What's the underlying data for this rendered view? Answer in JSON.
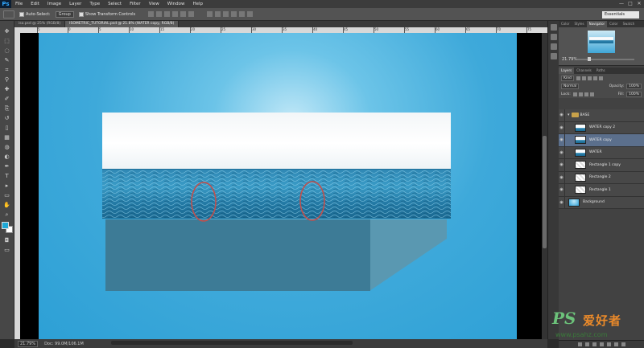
{
  "app": {
    "logo": "Ps",
    "menu": [
      "File",
      "Edit",
      "Image",
      "Layer",
      "Type",
      "Select",
      "Filter",
      "View",
      "Window",
      "Help"
    ],
    "window_controls": [
      "—",
      "□",
      "✕"
    ]
  },
  "options_bar": {
    "auto_select_label": "Auto-Select:",
    "auto_select_value": "Group",
    "transform_controls_label": "Show Transform Controls",
    "workspace": "Essentials"
  },
  "document_tabs": [
    {
      "label": "iso.psd @ 25% (RGB/8)",
      "active": false
    },
    {
      "label": "ISOMETRIC_TUTORIAL.psd @ 21.8% (WATER copy, RGB/8)",
      "active": true
    }
  ],
  "toolbar": {
    "tools": [
      "move-tool",
      "marquee-tool",
      "lasso-tool",
      "quick-select-tool",
      "crop-tool",
      "eyedropper-tool",
      "healing-tool",
      "brush-tool",
      "clone-tool",
      "history-brush-tool",
      "eraser-tool",
      "gradient-tool",
      "blur-tool",
      "dodge-tool",
      "pen-tool",
      "type-tool",
      "path-select-tool",
      "shape-tool",
      "hand-tool",
      "zoom-tool"
    ],
    "foreground_color": "#1ea8d6",
    "background_color": "#ffffff"
  },
  "rulers": {
    "top_numbers": [
      "5",
      "0",
      "5",
      "10",
      "15",
      "20",
      "25",
      "30",
      "35",
      "40",
      "45",
      "50",
      "55",
      "60",
      "65",
      "70",
      "75"
    ]
  },
  "status_bar": {
    "zoom": "21.79%",
    "doc_info": "Doc: 99.0M/106.1M"
  },
  "navigator": {
    "tabs": [
      "Color",
      "Styles",
      "Navigator",
      "Color",
      "Swatch"
    ],
    "active_tab": "Navigator",
    "zoom": "21.79%"
  },
  "layers_panel": {
    "tabs": [
      "Layers",
      "Channels",
      "Paths"
    ],
    "active_tab": "Layers",
    "kind_label": "Kind",
    "blend_mode": "Normal",
    "opacity_label": "Opacity:",
    "opacity_value": "100%",
    "lock_label": "Lock:",
    "fill_label": "Fill:",
    "fill_value": "100%",
    "group_name": "BASE",
    "layers": [
      {
        "name": "WATER copy 2",
        "selected": false,
        "thumb": "water"
      },
      {
        "name": "WATER copy",
        "selected": true,
        "thumb": "water"
      },
      {
        "name": "WATER",
        "selected": false,
        "thumb": "water"
      },
      {
        "name": "Rectangle 1 copy",
        "selected": false,
        "thumb": "rect"
      },
      {
        "name": "Rectangle 2",
        "selected": false,
        "thumb": "rect"
      },
      {
        "name": "Rectangle 1",
        "selected": false,
        "thumb": "rect"
      },
      {
        "name": "Background",
        "selected": false,
        "thumb": "bg"
      }
    ]
  },
  "canvas": {
    "highlight_color": "#c0504d",
    "side_front_color": "#3d7b96",
    "side_right_color": "#5a98b1"
  },
  "watermark": {
    "logo": "PS",
    "cn_text": "爱好者",
    "url": "www.psahz.com"
  }
}
